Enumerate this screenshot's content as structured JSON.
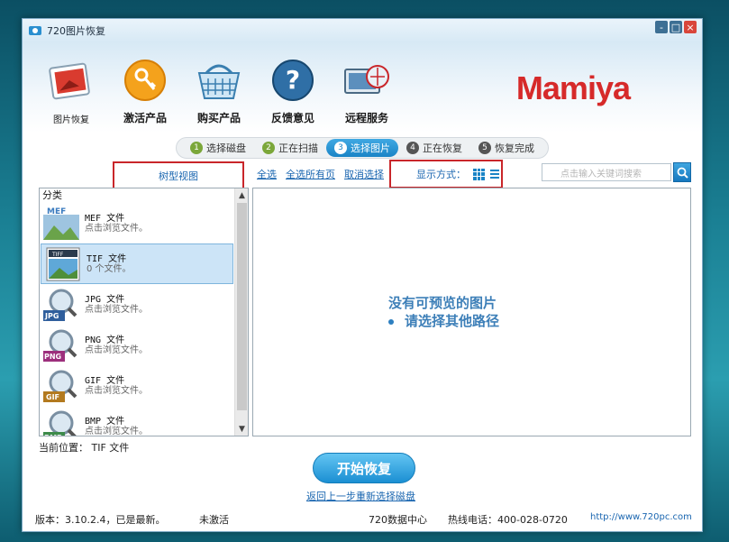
{
  "window": {
    "title": "720图片恢复",
    "controls": [
      "-",
      "□",
      "×"
    ]
  },
  "toolbar": {
    "items": [
      {
        "label": "图片恢复",
        "icon": "photo-recovery-icon"
      },
      {
        "label": "激活产品",
        "icon": "key-icon"
      },
      {
        "label": "购买产品",
        "icon": "basket-icon"
      },
      {
        "label": "反馈意见",
        "icon": "help-icon"
      },
      {
        "label": "远程服务",
        "icon": "remote-service-icon"
      }
    ],
    "brand": "Mamiya"
  },
  "steps": [
    {
      "num": "1",
      "label": "选择磁盘",
      "state": "done"
    },
    {
      "num": "2",
      "label": "正在扫描",
      "state": "done"
    },
    {
      "num": "3",
      "label": "选择图片",
      "state": "active"
    },
    {
      "num": "4",
      "label": "正在恢复",
      "state": "pending"
    },
    {
      "num": "5",
      "label": "恢复完成",
      "state": "pending"
    }
  ],
  "filter": {
    "tree_view": "树型视图",
    "select_all": "全选",
    "select_all_pages": "全选所有页",
    "cancel_select": "取消选择",
    "display_mode": "显示方式：",
    "search_placeholder": "点击输入关键词搜索"
  },
  "categories": {
    "header": "分类",
    "items": [
      {
        "title": "MEF 文件",
        "sub": "点击浏览文件。",
        "icon": "mef-file-icon",
        "selected": false
      },
      {
        "title": "TIF 文件",
        "sub": "0 个文件。",
        "icon": "tif-file-icon",
        "selected": true
      },
      {
        "title": "JPG 文件",
        "sub": "点击浏览文件。",
        "icon": "jpg-file-icon",
        "selected": false
      },
      {
        "title": "PNG 文件",
        "sub": "点击浏览文件。",
        "icon": "png-file-icon",
        "selected": false
      },
      {
        "title": "GIF 文件",
        "sub": "点击浏览文件。",
        "icon": "gif-file-icon",
        "selected": false
      },
      {
        "title": "BMP 文件",
        "sub": "点击浏览文件。",
        "icon": "bmp-file-icon",
        "selected": false
      }
    ]
  },
  "preview": {
    "line1": "没有可预览的图片",
    "line2": "请选择其他路径"
  },
  "location": "当前位置： TIF 文件",
  "actions": {
    "start_recover": "开始恢复",
    "back_link": "返回上一步重新选择磁盘"
  },
  "status": {
    "version": "版本：3.10.2.4，已是最新。",
    "activation": "未激活",
    "center": "720数据中心",
    "hotline": "热线电话：400-028-0720",
    "url": "http://www.720pc.com"
  },
  "colors": {
    "accent": "#1a84c6",
    "brand": "#d62a2a",
    "highlight_box": "#c9262a",
    "link": "#1a66b0"
  }
}
